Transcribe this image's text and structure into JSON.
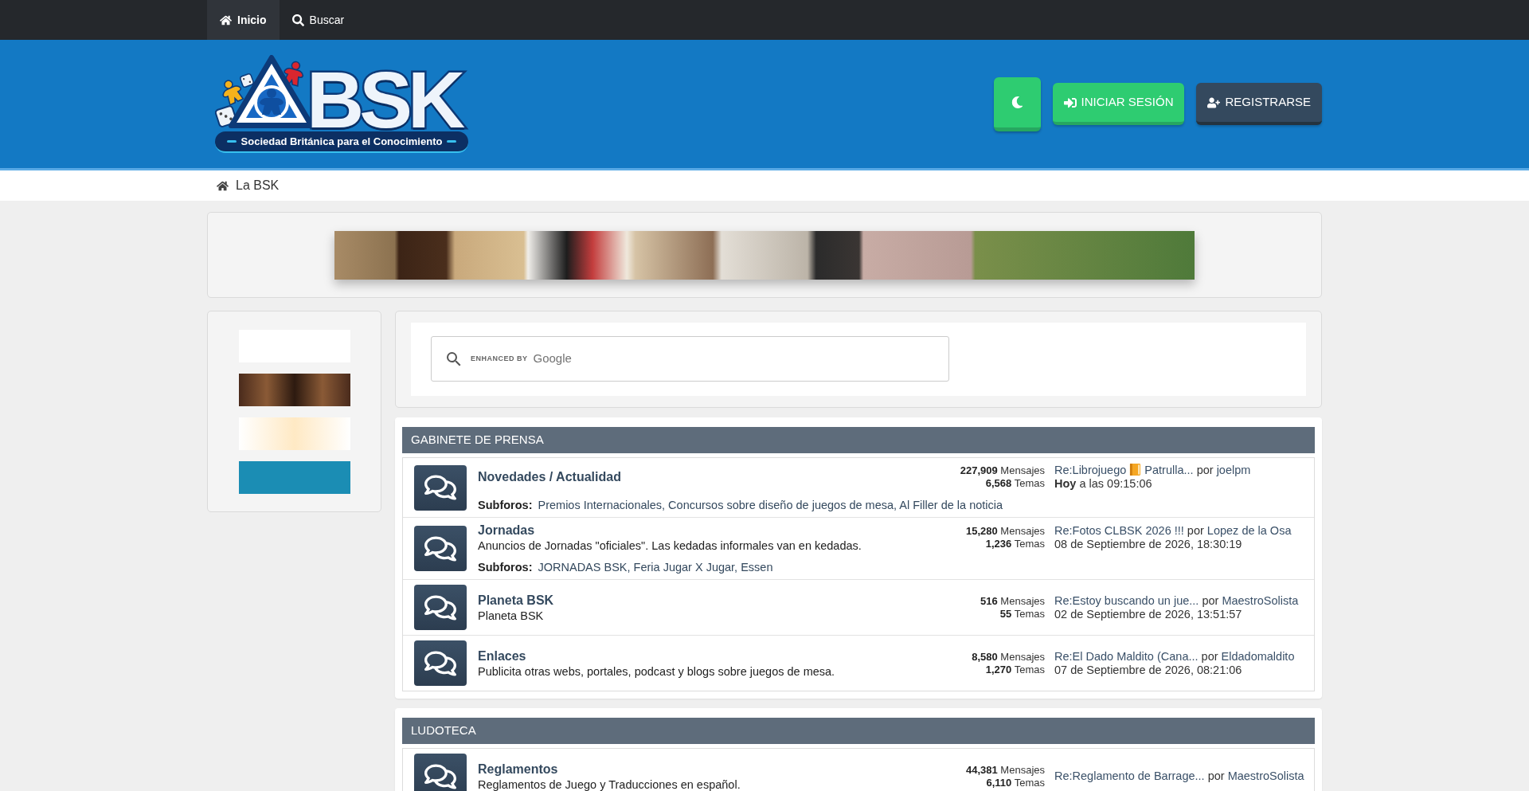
{
  "nav": {
    "items": [
      {
        "label": "Inicio",
        "selected": true
      },
      {
        "label": "Buscar",
        "selected": false
      }
    ]
  },
  "header": {
    "logo": {
      "wordmark": "BSK",
      "tagline": "Sociedad Británica para el Conocimiento"
    },
    "buttons": [
      {
        "label": "INICIAR SESIÓN",
        "kind": "primary"
      },
      {
        "label": "REGISTRARSE",
        "kind": "secondary"
      }
    ]
  },
  "breadcrumb": {
    "items": [
      "La BSK"
    ]
  },
  "search": {
    "enhanced_by": "ENHANCED BY",
    "brand": "Google"
  },
  "categories": [
    {
      "title": "GABINETE DE PRENSA",
      "forums": [
        {
          "title": "Novedades / Actualidad",
          "subforums_label": "Subforos:",
          "subforums": [
            "Premios Internacionales,",
            "Concursos sobre diseño de juegos de mesa,",
            "Al Filler de la noticia"
          ],
          "posts": "**227,909** Mensajes",
          "topics": "**6,568** Temas",
          "last_post": {
            "topic": [
              {
                "kind": "text",
                "text": "Re:Librojuego "
              },
              {
                "kind": "emoji"
              },
              {
                "kind": "text",
                "text": " Patrulla..."
              }
            ],
            "by": "por",
            "author": "joelpm",
            "date": "**Hoy** a las 09:15:06"
          }
        },
        {
          "title": "Jornadas",
          "description": "Anuncios de Jornadas \"oficiales\". Las kedadas informales van en kedadas.",
          "subforums_label": "Subforos:",
          "subforums": [
            "JORNADAS BSK,",
            "Feria Jugar X Jugar,",
            "Essen"
          ],
          "posts": "**15,280** Mensajes",
          "topics": "**1,236** Temas",
          "last_post": {
            "topic": [
              {
                "kind": "text",
                "text": "Re:Fotos CLBSK 2026 !!!"
              }
            ],
            "by": "por",
            "author": "Lopez de la Osa",
            "date": "08 de Septiembre de 2026, 18:30:19"
          }
        },
        {
          "title": "Planeta BSK",
          "description": "Planeta BSK",
          "posts": "**516** Mensajes",
          "topics": "**55** Temas",
          "last_post": {
            "topic": [
              {
                "kind": "text",
                "text": "Re:Estoy buscando un jue..."
              }
            ],
            "by": "por",
            "author": "MaestroSolista",
            "date": "02 de Septiembre de 2026, 13:51:57"
          }
        },
        {
          "title": "Enlaces",
          "description": "Publicita otras webs, portales, podcast y blogs sobre juegos de mesa.",
          "posts": "**8,580** Mensajes",
          "topics": "**1,270** Temas",
          "last_post": {
            "topic": [
              {
                "kind": "text",
                "text": "Re:El Dado Maldito (Cana..."
              }
            ],
            "by": "por",
            "author": "Eldadomaldito",
            "date": "07 de Septiembre de 2026, 08:21:06"
          }
        }
      ]
    },
    {
      "title": "LUDOTECA",
      "forums": [
        {
          "title": "Reglamentos",
          "description": "Reglamentos de Juego y Traducciones en español.",
          "posts": "**44,381** Mensajes",
          "topics": "**6,110** Temas",
          "last_post": {
            "topic": [
              {
                "kind": "text",
                "text": "Re:Reglamento de Barrage..."
              }
            ],
            "by": "por",
            "author": "MaestroSolista"
          }
        }
      ]
    }
  ]
}
